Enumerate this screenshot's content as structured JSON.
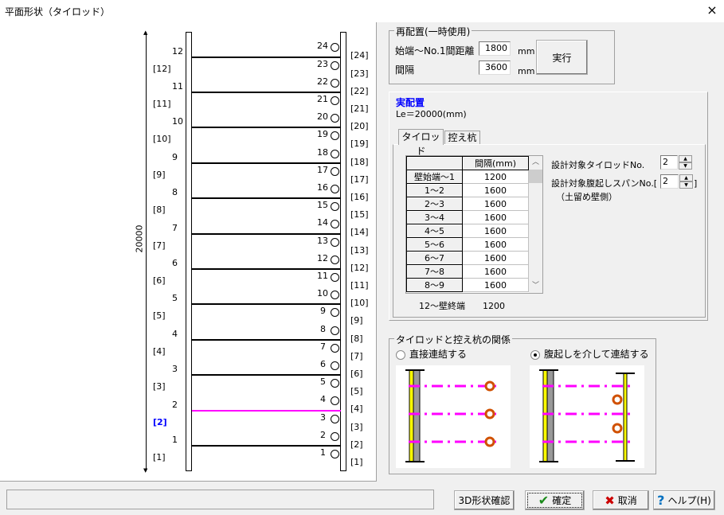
{
  "window": {
    "title": "平面形状（タイロッド）",
    "close_icon": "×"
  },
  "drawing": {
    "total_length_label": "20000",
    "rods": [
      "1",
      "2",
      "3",
      "4",
      "5",
      "6",
      "7",
      "8",
      "9",
      "10",
      "11",
      "12"
    ],
    "selected_rod_index": 1,
    "spans": [
      "[1]",
      "[2]",
      "[3]",
      "[4]",
      "[5]",
      "[6]",
      "[7]",
      "[8]",
      "[9]",
      "[10]",
      "[11]",
      "[12]"
    ],
    "selected_span_index": 1,
    "piles": [
      "1",
      "2",
      "3",
      "4",
      "5",
      "6",
      "7",
      "8",
      "9",
      "10",
      "11",
      "12",
      "13",
      "14",
      "15",
      "16",
      "17",
      "18",
      "19",
      "20",
      "21",
      "22",
      "23",
      "24"
    ],
    "pile_spans": [
      "[1]",
      "[2]",
      "[3]",
      "[4]",
      "[5]",
      "[6]",
      "[7]",
      "[8]",
      "[9]",
      "[10]",
      "[11]",
      "[12]",
      "[13]",
      "[14]",
      "[15]",
      "[16]",
      "[17]",
      "[18]",
      "[19]",
      "[20]",
      "[21]",
      "[22]",
      "[23]",
      "[24]"
    ],
    "colors": {
      "selected_rod": "#ff00ff",
      "selected_span": "#0000ff"
    }
  },
  "relocate": {
    "legend": "再配置(一時使用)",
    "start_label": "始端～No.1間距離",
    "start_value": "1800",
    "pitch_label": "間隔",
    "pitch_value": "3600",
    "unit": "mm",
    "execute_label": "実行"
  },
  "actual": {
    "title": "実配置",
    "le": "Le＝20000(mm)",
    "tabs": [
      "タイロッド",
      "控え杭"
    ],
    "table": {
      "header": "間隔(mm)",
      "rows": [
        [
          "壁始端～1",
          "1200"
        ],
        [
          "1～2",
          "1600"
        ],
        [
          "2～3",
          "1600"
        ],
        [
          "3～4",
          "1600"
        ],
        [
          "4～5",
          "1600"
        ],
        [
          "5～6",
          "1600"
        ],
        [
          "6～7",
          "1600"
        ],
        [
          "7～8",
          "1600"
        ],
        [
          "8～9",
          "1600"
        ]
      ]
    },
    "end_label": "12～壁終端",
    "end_value": "1200",
    "design_rod_label": "設計対象タイロッドNo.",
    "design_rod_value": "2",
    "design_span_label": "設計対象腹起しスパンNo.[",
    "design_span_value": "2",
    "design_span_close": "]",
    "design_span_note": "（土留め壁側）"
  },
  "relation": {
    "legend": "タイロッドと控え杭の関係",
    "options": [
      "直接連結する",
      "腹起しを介して連結する"
    ],
    "selected": 1
  },
  "footer": {
    "status": "",
    "btn_3d": "3D形状確認",
    "btn_ok": "確定",
    "btn_cancel": "取消",
    "btn_help": "ヘルプ(H)"
  }
}
